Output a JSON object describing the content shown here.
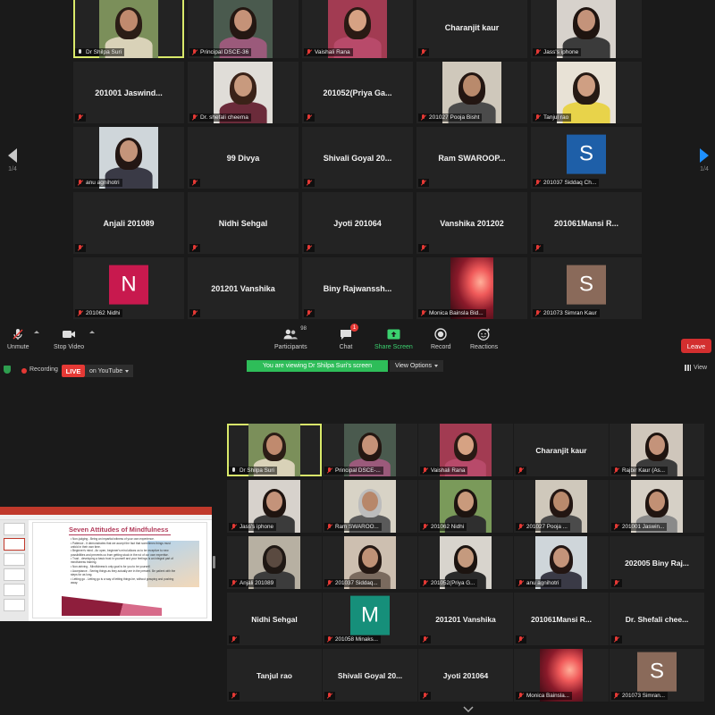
{
  "top_gallery": {
    "page_left": "1/4",
    "page_right": "1/4",
    "tiles": [
      {
        "label": "Dr Shilpa Suri",
        "type": "video",
        "active": true,
        "mic": "on",
        "bg": "#7b8f5a",
        "face": "#c08a6e",
        "hair": "#2b1d16",
        "shirt": "#d9d2b8"
      },
      {
        "label": "Principal DSCE-36",
        "type": "video",
        "mic": "off",
        "bg": "#4a5a4e",
        "face": "#c59278",
        "hair": "#241712",
        "shirt": "#9b5a7b"
      },
      {
        "label": "Vaishali Rana",
        "type": "video",
        "mic": "off",
        "bg": "#a23b52",
        "face": "#d6a283",
        "hair": "#2a1a14",
        "shirt": "#b84a6a"
      },
      {
        "label": "",
        "name": "Charanjit kaur",
        "type": "name"
      },
      {
        "label": "Jass's iphone",
        "type": "video",
        "mic": "off",
        "bg": "#d7d2cc",
        "face": "#c4937a",
        "hair": "#1f1410",
        "shirt": "#3b3b3b"
      },
      {
        "label": "",
        "name": "201001 Jaswind...",
        "type": "name"
      },
      {
        "label": "Dr. shefali cheema",
        "type": "video",
        "mic": "off",
        "bg": "#e0ddd8",
        "face": "#c89a7e",
        "hair": "#3a2218",
        "shirt": "#6b2b3a"
      },
      {
        "label": "",
        "name": "201052(Priya Ga...",
        "type": "name"
      },
      {
        "label": "201027 Pooja Bisht",
        "type": "video",
        "mic": "off",
        "bg": "#cfc8bb",
        "face": "#b98a6c",
        "hair": "#231612",
        "shirt": "#4b4b4b"
      },
      {
        "label": "Tanjul rao",
        "type": "video",
        "mic": "off",
        "bg": "#e8e2d6",
        "face": "#cf9f83",
        "hair": "#261a14",
        "shirt": "#e8d34a"
      },
      {
        "label": "anu agnihotri",
        "type": "video",
        "mic": "off",
        "bg": "#cfd6da",
        "face": "#c4947a",
        "hair": "#231613",
        "shirt": "#3a3a46"
      },
      {
        "label": "",
        "name": "99 Divya",
        "type": "name"
      },
      {
        "label": "",
        "name": "Shivali Goyal 20...",
        "type": "name"
      },
      {
        "label": "",
        "name": "Ram  SWAROOP...",
        "type": "name"
      },
      {
        "label": "201037 Siddaq Ch...",
        "type": "letter",
        "letter": "S",
        "color": "#1e5fa8"
      },
      {
        "label": "",
        "name": "Anjali 201089",
        "type": "name"
      },
      {
        "label": "",
        "name": "Nidhi Sehgal",
        "type": "name"
      },
      {
        "label": "",
        "name": "Jyoti 201064",
        "type": "name"
      },
      {
        "label": "",
        "name": "Vanshika 201202",
        "type": "name"
      },
      {
        "label": "",
        "name": "201061Mansi R...",
        "type": "name"
      },
      {
        "label": "201062 Nidhi",
        "type": "letter",
        "letter": "N",
        "color": "#c8194e"
      },
      {
        "label": "",
        "name": "201201 Vanshika",
        "type": "name"
      },
      {
        "label": "",
        "name": "Biny Rajwanssh...",
        "type": "name"
      },
      {
        "label": "Monica Bainsla Bid...",
        "type": "flower"
      },
      {
        "label": "201073 Simran Kaur",
        "type": "letter",
        "letter": "S",
        "color": "#8a6a5a"
      }
    ]
  },
  "toolbar": {
    "unmute": "Unmute",
    "stop_video": "Stop Video",
    "participants": "Participants",
    "participants_count": "98",
    "chat": "Chat",
    "chat_badge": "1",
    "share_screen": "Share Screen",
    "record": "Record",
    "reactions": "Reactions",
    "leave": "Leave"
  },
  "status_bar": {
    "recording": "Recording",
    "live": "LIVE",
    "youtube": "on YouTube",
    "banner": "You are viewing Dr Shilpa Suri's screen",
    "view_options": "View Options",
    "view": "View"
  },
  "slide": {
    "title": "Seven Attitudes of Mindfulness",
    "bullets": [
      "Non-judging - Being an impartial witness of your own experience.",
      "Patience - It demonstrates that we accept the fact that sometimes things must unfold in their own time.",
      "Beginner's mind - An open, beginner's mind allows us to be receptive to new possibilities and prevents us from getting stuck in the rut of our own expertise.",
      "Trust - developing a basic trust in yourself and your feelings is an integral part of mindfulness training.",
      "Non-striving - Mindfulness's only goal is for you to be yourself.",
      "Acceptance - Seeing things as they actually are in the present. Be patient with the steps for as long.",
      "Letting go - Letting go is a way of letting things be, without grasping and pushing away."
    ]
  },
  "bottom_gallery": {
    "tiles": [
      {
        "label": "Dr Shilpa Suri",
        "type": "video",
        "active": true,
        "mic": "on",
        "bg": "#7b8f5a",
        "face": "#c08a6e",
        "hair": "#2b1d16",
        "shirt": "#d9d2b8"
      },
      {
        "label": "Principal DSCE-...",
        "type": "video",
        "mic": "off",
        "bg": "#4a5a4e",
        "face": "#c59278",
        "hair": "#241712",
        "shirt": "#9b5a7b"
      },
      {
        "label": "Vaishali Rana",
        "type": "video",
        "mic": "off",
        "bg": "#a23b52",
        "face": "#d6a283",
        "hair": "#2a1a14",
        "shirt": "#b84a6a"
      },
      {
        "label": "",
        "name": "Charanjit kaur",
        "type": "name"
      },
      {
        "label": "Rajbir Kaur (As...",
        "type": "video",
        "mic": "off",
        "bg": "#cfc6bb",
        "face": "#c4937a",
        "hair": "#1f1410",
        "shirt": "#3b3b3b"
      },
      {
        "label": "Jass's iphone",
        "type": "video",
        "mic": "off",
        "bg": "#d7d2cc",
        "face": "#c4937a",
        "hair": "#1f1410",
        "shirt": "#3b3b3b"
      },
      {
        "label": "Ram SWAROO...",
        "type": "video",
        "mic": "off",
        "bg": "#d8d3c6",
        "face": "#b7876a",
        "hair": "#bcbcbc",
        "shirt": "#5a5a5a"
      },
      {
        "label": "201062 Nidhi",
        "type": "video",
        "mic": "off",
        "bg": "#7a9a5a",
        "face": "#c99a7c",
        "hair": "#1d1410",
        "shirt": "#2f2f2f"
      },
      {
        "label": "201027 Pooja ...",
        "type": "video",
        "mic": "off",
        "bg": "#cfc8bb",
        "face": "#b98a6c",
        "hair": "#231612",
        "shirt": "#4b4b4b"
      },
      {
        "label": "201001 Jaswin...",
        "type": "video",
        "mic": "off",
        "bg": "#d6d0c6",
        "face": "#c29074",
        "hair": "#211511",
        "shirt": "#8a8a8a"
      },
      {
        "label": "Anjali 201089",
        "type": "video",
        "mic": "off",
        "bg": "#b7b0a2",
        "face": "#5a4a40",
        "hair": "#1f1814",
        "shirt": "#3c3c3c"
      },
      {
        "label": "201037 Siddaq...",
        "type": "video",
        "mic": "off",
        "bg": "#cdbfb0",
        "face": "#c09276",
        "hair": "#241813",
        "shirt": "#7a6a5e"
      },
      {
        "label": "201052(Priya G...",
        "type": "video",
        "mic": "off",
        "bg": "#d8d4cd",
        "face": "#c59a7e",
        "hair": "#1c1410",
        "shirt": "#2a2a2a"
      },
      {
        "label": "anu agnihotri",
        "type": "video",
        "mic": "off",
        "bg": "#cfd6da",
        "face": "#c4947a",
        "hair": "#231613",
        "shirt": "#3a3a46"
      },
      {
        "label": "",
        "name": "202005 Biny Raj...",
        "type": "name"
      },
      {
        "label": "",
        "name": "Nidhi Sehgal",
        "type": "name"
      },
      {
        "label": "201058 Minaks...",
        "type": "letter",
        "letter": "M",
        "color": "#168f7a"
      },
      {
        "label": "",
        "name": "201201 Vanshika",
        "type": "name"
      },
      {
        "label": "",
        "name": "201061Mansi R...",
        "type": "name"
      },
      {
        "label": "",
        "name": "Dr. Shefali chee...",
        "type": "name"
      },
      {
        "label": "",
        "name": "Tanjul rao",
        "type": "name"
      },
      {
        "label": "",
        "name": "Shivali Goyal 20...",
        "type": "name"
      },
      {
        "label": "",
        "name": "Jyoti 201064",
        "type": "name"
      },
      {
        "label": "Monica Bainsla...",
        "type": "flower"
      },
      {
        "label": "201073 Simran...",
        "type": "letter",
        "letter": "S",
        "color": "#8a6a5a"
      }
    ]
  }
}
